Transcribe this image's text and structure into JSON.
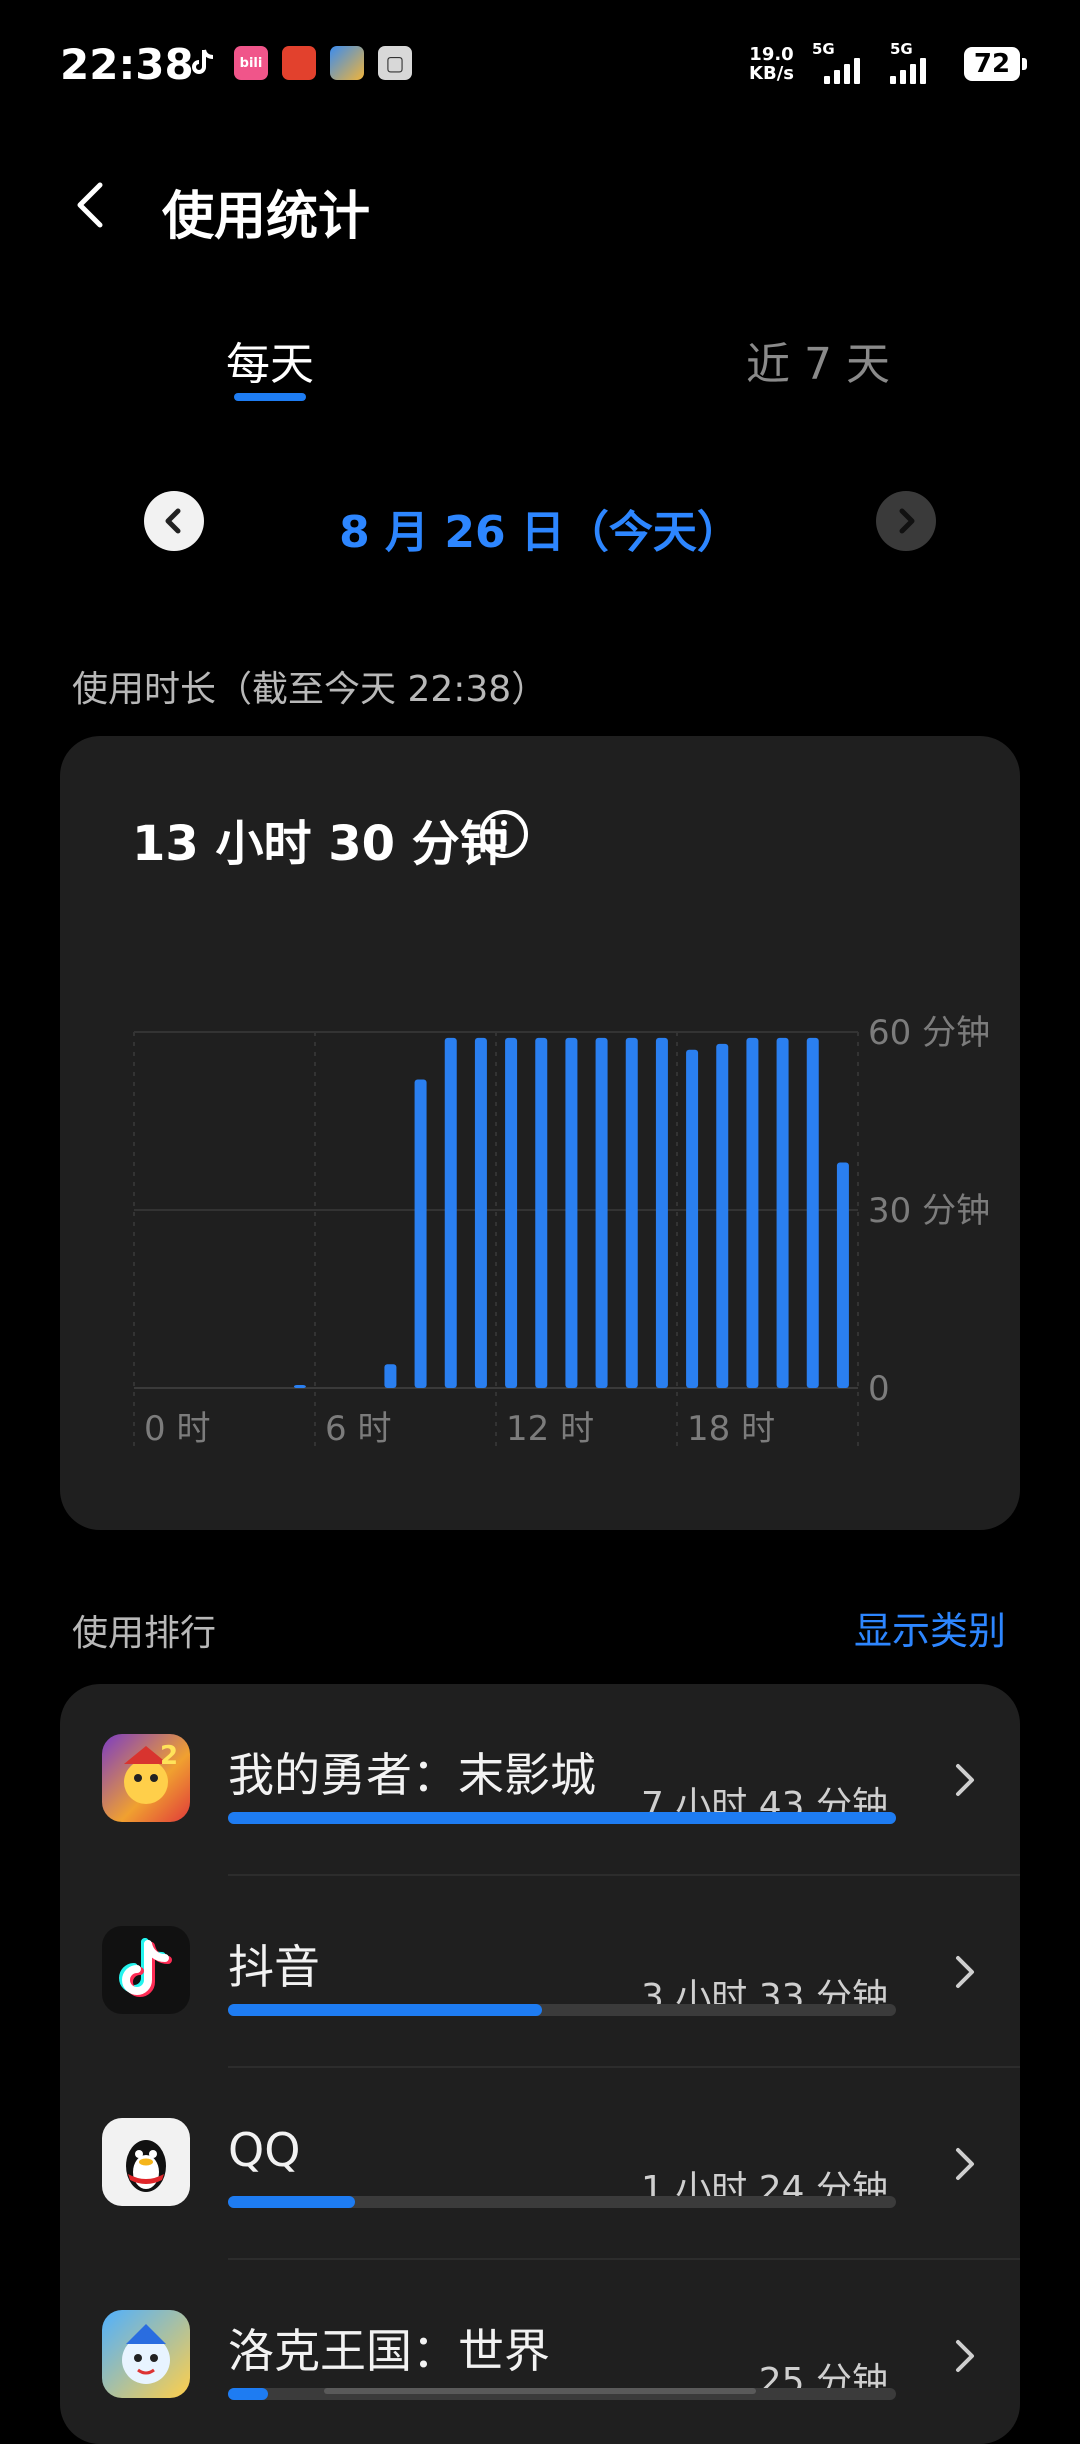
{
  "status_bar": {
    "time": "22:38",
    "net_speed_value": "19.0",
    "net_speed_unit": "KB/s",
    "sim1": "5G",
    "sim2": "5G",
    "battery": "72",
    "notification_icons": [
      "tiktok-icon",
      "bilibili-icon",
      "app-icon-red",
      "app-icon-blue",
      "app-icon-gray"
    ]
  },
  "header": {
    "title": "使用统计"
  },
  "tabs": [
    {
      "label": "每天",
      "active": true
    },
    {
      "label": "近 7 天",
      "active": false
    }
  ],
  "date_nav": {
    "label": "8 月 26 日（今天）"
  },
  "usage": {
    "section_label": "使用时长（截至今天 22:38）",
    "total": "13 小时 30 分钟"
  },
  "chart_data": {
    "type": "bar",
    "categories": [
      "0",
      "1",
      "2",
      "3",
      "4",
      "5",
      "6",
      "7",
      "8",
      "9",
      "10",
      "11",
      "12",
      "13",
      "14",
      "15",
      "16",
      "17",
      "18",
      "19",
      "20",
      "21",
      "22",
      "23"
    ],
    "values": [
      0,
      0,
      0,
      0,
      0,
      0.5,
      0,
      0,
      4,
      52,
      59,
      59,
      59,
      59,
      59,
      59,
      59,
      59,
      57,
      58,
      59,
      59,
      59,
      38
    ],
    "x_tick_labels": [
      "0 时",
      "6 时",
      "12 时",
      "18 时"
    ],
    "y_tick_labels": [
      "60 分钟",
      "30 分钟",
      "0"
    ],
    "ylim": [
      0,
      60
    ],
    "grid": true,
    "bar_color": "#2a7ff0"
  },
  "ranking": {
    "section_label": "使用排行",
    "show_category": "显示类别",
    "items": [
      {
        "name": "我的勇者：末影城",
        "time": "7 小时 43 分钟",
        "fraction": 1.0,
        "icon": "brave-game-icon"
      },
      {
        "name": "抖音",
        "time": "3 小时 33 分钟",
        "fraction": 0.47,
        "icon": "douyin-icon"
      },
      {
        "name": "QQ",
        "time": "1 小时 24 分钟",
        "fraction": 0.19,
        "icon": "qq-penguin-icon"
      },
      {
        "name": "洛克王国：世界",
        "time": "25 分钟",
        "fraction": 0.06,
        "icon": "roco-kingdom-icon"
      }
    ]
  },
  "colors": {
    "accent": "#1e7cf2",
    "card": "#1f1f1f",
    "background": "#000000"
  }
}
